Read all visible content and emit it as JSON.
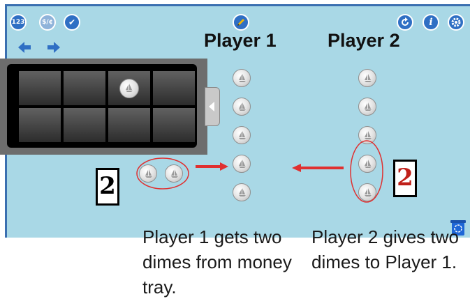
{
  "toolbar": {
    "number_mode_label": "123",
    "money_mode_label": "$/¢",
    "check_label": "✔",
    "edit_icon": "pencil-icon",
    "reset_icon": "refresh-icon",
    "info_label": "i",
    "settings_icon": "gear-icon",
    "back_icon": "arrow-left-icon",
    "forward_icon": "arrow-right-icon"
  },
  "players": [
    {
      "title": "Player 1",
      "coins": 5
    },
    {
      "title": "Player 2",
      "coins": 5
    }
  ],
  "tray": {
    "rows": 2,
    "cols": 4,
    "coin_in_cell": 3
  },
  "annotations": {
    "left_number": "2",
    "right_number": "2",
    "left_caption": "Player 1 gets two dimes from money tray.",
    "right_caption": "Player 2 gives two dimes to Player 1."
  },
  "colors": {
    "background": "#a9d8e6",
    "accent": "#3a6fb0",
    "annotation_red": "#e03030"
  }
}
